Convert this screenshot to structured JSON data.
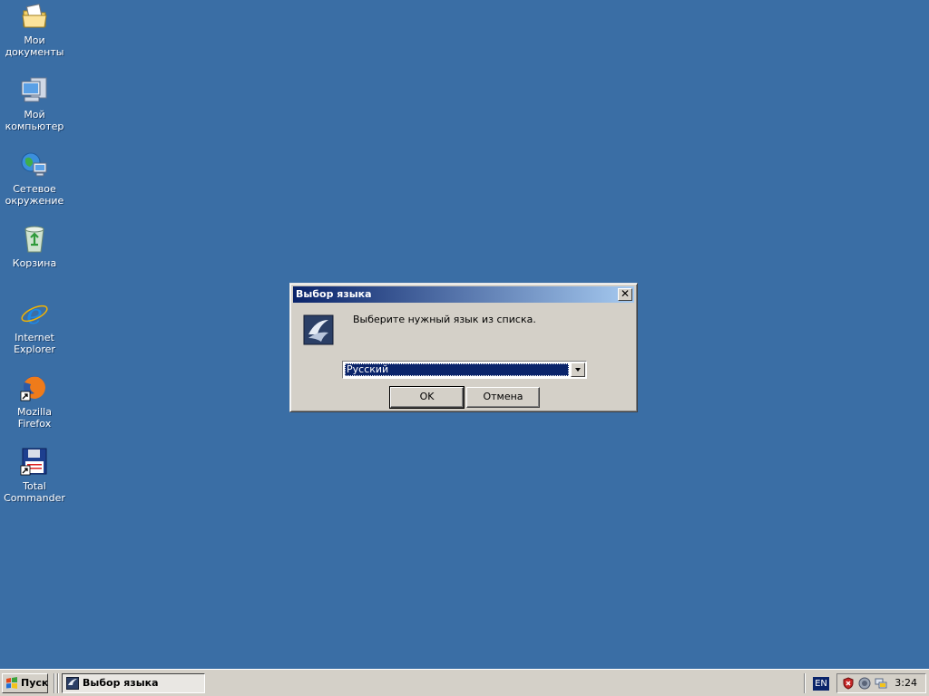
{
  "desktop": {
    "icons": [
      {
        "label": "Мои документы",
        "icon": "folder-documents-icon"
      },
      {
        "label": "Мой компьютер",
        "icon": "computer-icon"
      },
      {
        "label": "Сетевое окружение",
        "icon": "network-icon"
      },
      {
        "label": "Корзина",
        "icon": "recycle-bin-icon"
      },
      {
        "label": "Internet Explorer",
        "icon": "internet-explorer-icon"
      },
      {
        "label": "Mozilla Firefox",
        "icon": "firefox-icon"
      },
      {
        "label": "Total Commander",
        "icon": "floppy-icon"
      }
    ]
  },
  "dialog": {
    "title": "Выбор языка",
    "message": "Выберите нужный язык из списка.",
    "language_selected": "Русский",
    "ok_label": "OK",
    "cancel_label": "Отмена"
  },
  "taskbar": {
    "start_label": "Пуск",
    "task_label": "Выбор языка",
    "language_indicator": "EN",
    "clock": "3:24"
  },
  "colors": {
    "desktop": "#3a6ea5",
    "title_start": "#0a246a",
    "title_end": "#a6caf0",
    "face": "#d4d0c8"
  }
}
